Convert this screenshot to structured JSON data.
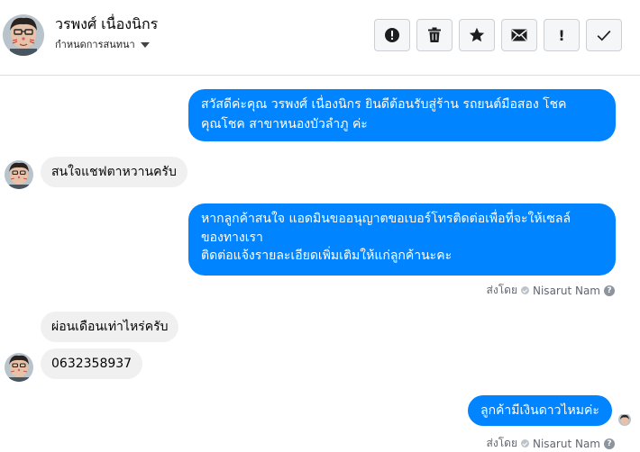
{
  "header": {
    "contact_name": "วรพงศ์ เนื่องนิกร",
    "conversation_settings": "กำหนดการสนทนา",
    "actions": [
      {
        "name": "report-icon"
      },
      {
        "name": "trash-icon"
      },
      {
        "name": "star-icon"
      },
      {
        "name": "mail-icon"
      },
      {
        "name": "priority-icon",
        "label": "!"
      },
      {
        "name": "check-icon"
      }
    ]
  },
  "messages": [
    {
      "direction": "out",
      "lines": [
        "สวัสดีค่ะคุณ วรพงศ์ เนื่องนิกร ยินดีต้อนรับสู่ร้าน รถยนต์มือสอง โชค",
        "คุณโชค สาขาหนองบัวลำภู ค่ะ"
      ]
    },
    {
      "direction": "in",
      "text": "สนใจแชฟตาหวานครับ"
    },
    {
      "direction": "out",
      "lines": [
        "หากลูกค้าสนใจ แอดมินขออนุญาตขอเบอร์โทรติดต่อเพื่อที่จะให้เซลล์",
        "ของทางเรา",
        "ติดต่อแจ้งรายละเอียดเพิ่มเติมให้แก่ลูกค้านะคะ"
      ]
    },
    {
      "direction": "in",
      "text": "ผ่อนเดือนเท่าไหร่ครับ"
    },
    {
      "direction": "in",
      "text": "0632358937"
    },
    {
      "direction": "out",
      "text": "ลูกค้ามีเงินดาวไหมค่ะ"
    }
  ],
  "sent_by": {
    "prefix": "ส่งโดย",
    "name": "Nisarut Nam"
  },
  "colors": {
    "outgoing_bubble": "#0084ff",
    "incoming_bubble": "#f0f0f0"
  }
}
